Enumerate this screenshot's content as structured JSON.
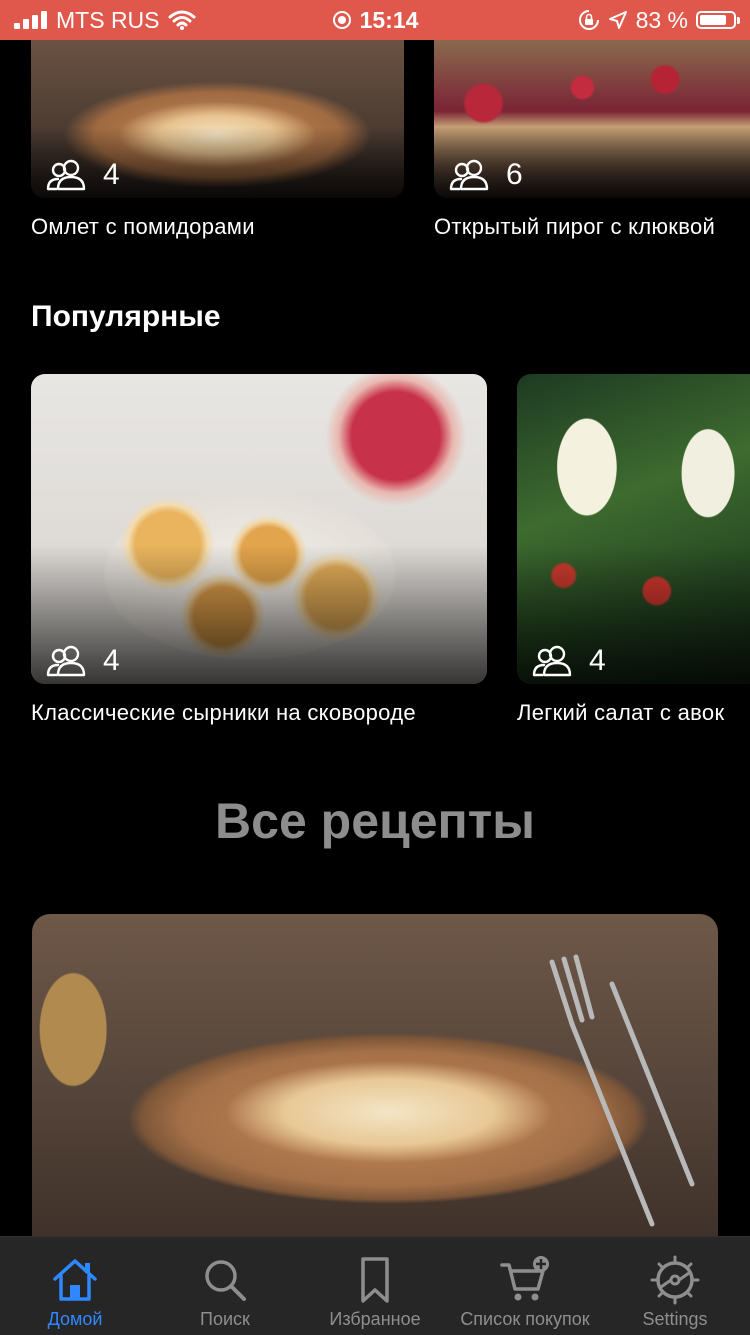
{
  "status_bar": {
    "carrier": "MTS RUS",
    "time": "15:14",
    "battery_percent": "83 %",
    "battery_level": 0.83
  },
  "top_row": [
    {
      "title": "Омлет с помидорами",
      "servings": "4"
    },
    {
      "title": "Открытый пирог с клюквой",
      "servings": "6"
    }
  ],
  "popular": {
    "heading": "Популярные",
    "items": [
      {
        "title": "Классические сырники на сковороде",
        "servings": "4"
      },
      {
        "title": "Легкий салат с авок",
        "servings": "4"
      }
    ]
  },
  "all_recipes": {
    "heading": "Все рецепты"
  },
  "tabs": [
    {
      "label": "Домой",
      "icon": "home-icon",
      "active": true
    },
    {
      "label": "Поиск",
      "icon": "search-icon",
      "active": false
    },
    {
      "label": "Избранное",
      "icon": "bookmark-icon",
      "active": false
    },
    {
      "label": "Список покупок",
      "icon": "cart-add-icon",
      "active": false
    },
    {
      "label": "Settings",
      "icon": "settings-icon",
      "active": false
    }
  ],
  "colors": {
    "status_bar": "#e0574c",
    "background": "#000000",
    "tab_bar": "#262626",
    "accent": "#2f88ff",
    "inactive": "#8e8e8e"
  }
}
